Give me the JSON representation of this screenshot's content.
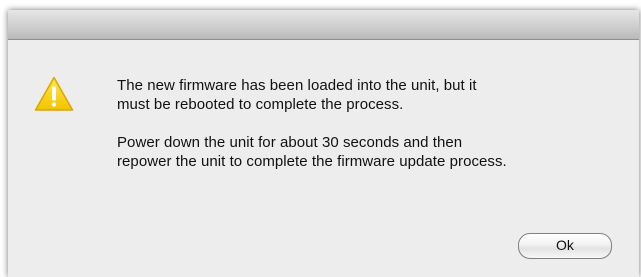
{
  "dialog": {
    "icon": "warning-icon",
    "message": {
      "line1": "The new firmware has been loaded into the unit, but it\nmust be rebooted to complete the process.",
      "line2": "Power down the unit for about 30 seconds and then\nrepower the unit to complete the firmware update process."
    },
    "buttons": {
      "ok_label": "Ok"
    }
  }
}
